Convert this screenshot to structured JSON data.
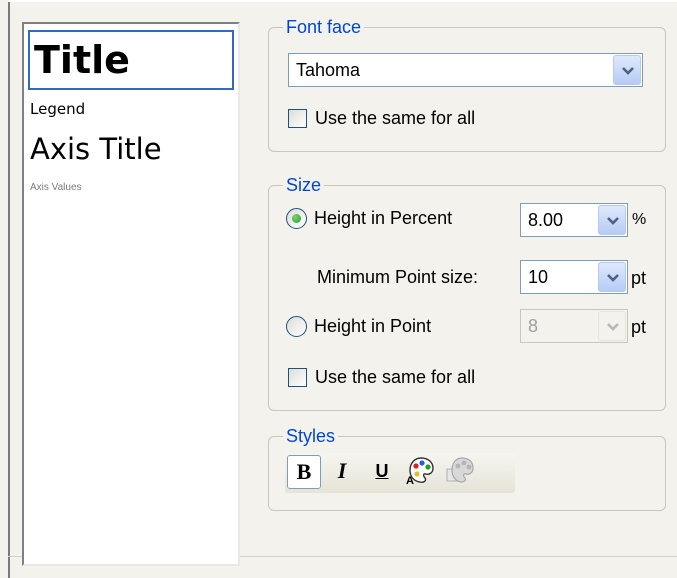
{
  "preview": {
    "title": "Title",
    "legend": "Legend",
    "axis_title": "Axis Title",
    "axis_values": "Axis Values"
  },
  "font_face": {
    "group_label": "Font face",
    "selected_font": "Tahoma",
    "same_for_all_label": "Use the same for all",
    "same_for_all_checked": false
  },
  "size": {
    "group_label": "Size",
    "height_percent_label": "Height in Percent",
    "height_percent_checked": true,
    "height_percent_value": "8.00",
    "height_percent_unit": "%",
    "min_point_label": "Minimum Point size:",
    "min_point_value": "10",
    "min_point_unit": "pt",
    "height_point_label": "Height in Point",
    "height_point_checked": false,
    "height_point_value": "8",
    "height_point_unit": "pt",
    "same_for_all_label": "Use the same for all",
    "same_for_all_checked": false
  },
  "styles": {
    "group_label": "Styles",
    "bold_label": "B",
    "italic_label": "I",
    "underline_label": "U",
    "bold_active": true
  },
  "colors": {
    "accent": "#0046d5",
    "selection_border": "#316ac5",
    "radio_dot": "#21a121"
  }
}
